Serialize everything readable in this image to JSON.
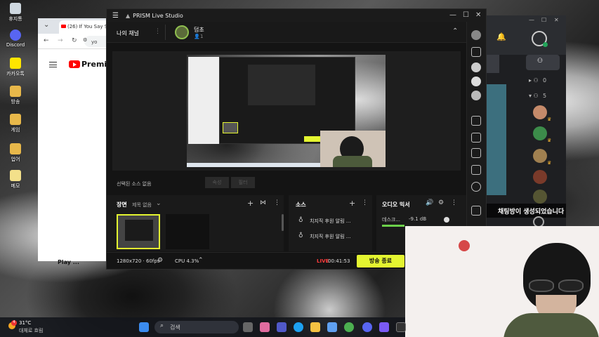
{
  "desktop_icons": [
    {
      "label": "휴지통"
    },
    {
      "label": "Discord"
    },
    {
      "label": "카카오톡"
    },
    {
      "label": "방송"
    },
    {
      "label": "게임"
    },
    {
      "label": "업어"
    },
    {
      "label": "메모"
    }
  ],
  "chrome": {
    "tab_title": "(26) If You Say So",
    "addr_text": "yo",
    "youtube_word": "Premiu",
    "bottom_text": "Play ..."
  },
  "prism": {
    "app_title": "PRISM Live Studio",
    "my_channel": "나의 채널",
    "channel_name": "덤초",
    "viewer_count": "1",
    "source_none": "선택된 소스 없음",
    "btn_a": "속성",
    "btn_b": "필터",
    "scene_label": "장면",
    "scene_name": "제목 없음",
    "source_label": "소스",
    "sources": [
      "치지직 후원 알림 ...",
      "치지직 후원 알림 ..."
    ],
    "mixer_label": "오디오 믹서",
    "mixer_device": "데스크...",
    "mixer_level": "-9.1 dB",
    "resolution": "1280x720 · 60fps",
    "cpu": "CPU 4.3%",
    "live_label": "LIVE",
    "live_time": "00:41:53",
    "end_button": "방송 종료"
  },
  "discord": {
    "cat1_count": "0",
    "cat2_count": "5",
    "toast": "채팅방이 생성되었습니다"
  },
  "taskbar": {
    "temp": "31°C",
    "weather": "대체로 흐림",
    "search_placeholder": "검색",
    "weather_badge": "4"
  },
  "colors": {
    "accent": "#e4f530",
    "live": "#ff3b3b",
    "discord_green": "#23a55a"
  }
}
